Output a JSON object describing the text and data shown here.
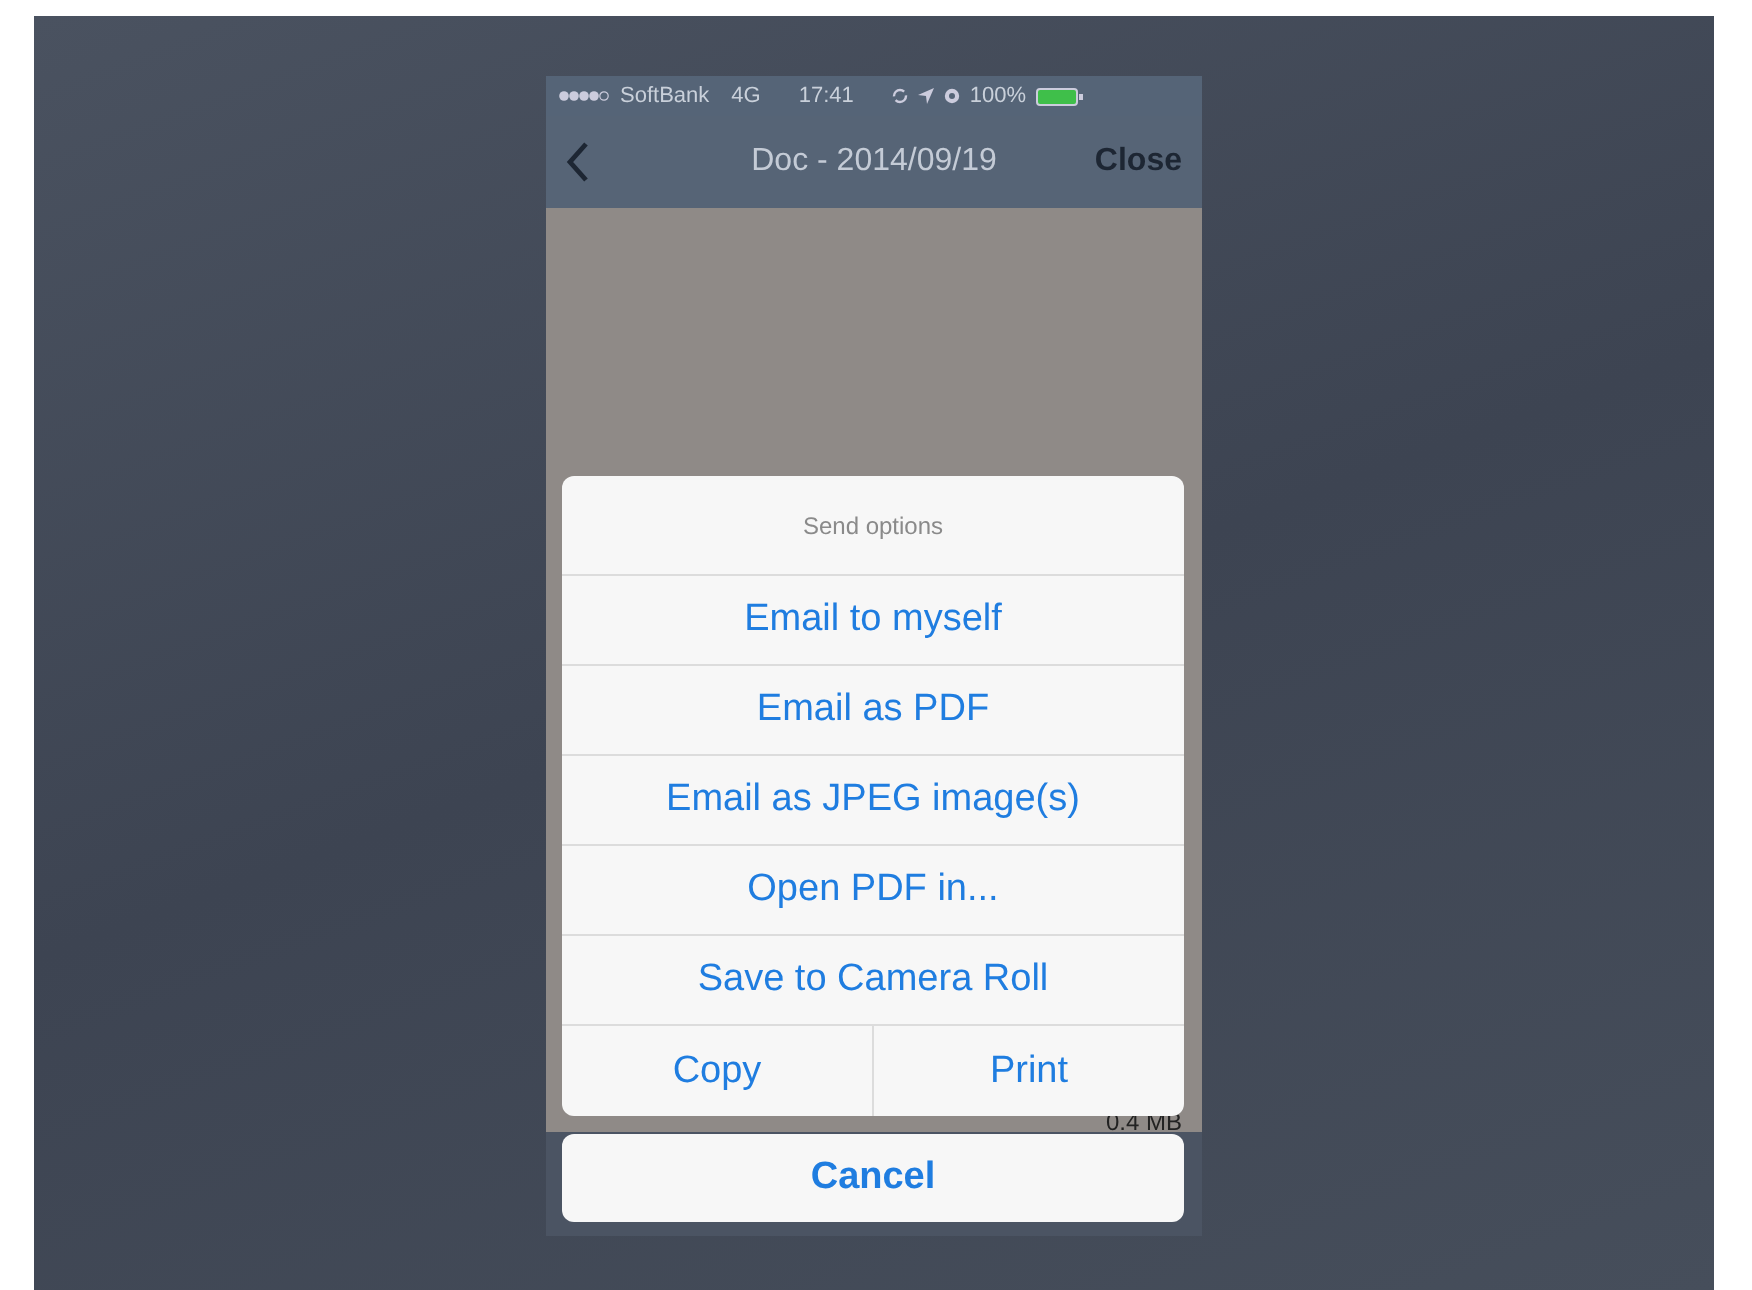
{
  "status_bar": {
    "carrier": "SoftBank",
    "network": "4G",
    "time": "17:41",
    "battery": "100%"
  },
  "nav_bar": {
    "title": "Doc - 2014/09/19",
    "close": "Close"
  },
  "document": {
    "size": "0.4 MB"
  },
  "action_sheet": {
    "title": "Send options",
    "actions": [
      {
        "label": "Email to myself"
      },
      {
        "label": "Email as PDF"
      },
      {
        "label": "Email as JPEG image(s)"
      },
      {
        "label": "Open PDF in..."
      },
      {
        "label": "Save to Camera Roll"
      }
    ],
    "pair": [
      {
        "label": "Copy"
      },
      {
        "label": "Print"
      }
    ],
    "cancel": "Cancel"
  }
}
